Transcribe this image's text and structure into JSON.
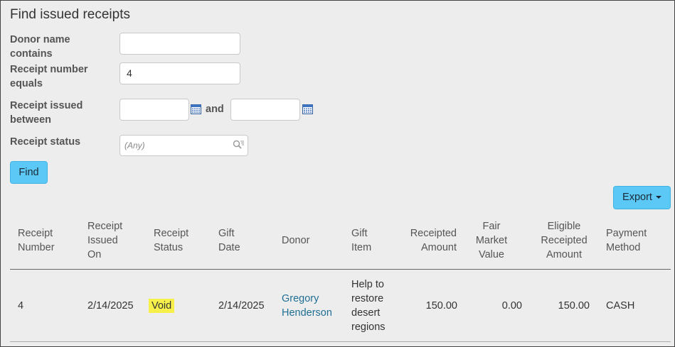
{
  "page": {
    "title": "Find issued receipts"
  },
  "form": {
    "donor_name_label": "Donor name contains",
    "donor_name_value": "",
    "receipt_number_label": "Receipt number equals",
    "receipt_number_value": "4",
    "issued_between_label": "Receipt issued between",
    "issued_from_value": "",
    "issued_and_label": "and",
    "issued_to_value": "",
    "receipt_status_label": "Receipt status",
    "receipt_status_placeholder": "(Any)",
    "find_label": "Find"
  },
  "toolbar": {
    "export_label": "Export"
  },
  "table": {
    "headers": [
      "Receipt Number",
      "Receipt Issued On",
      "Receipt Status",
      "Gift Date",
      "Donor",
      "Gift Item",
      "Receipted Amount",
      "Fair Market Value",
      "Eligible Receipted Amount",
      "Payment Method"
    ],
    "rows": [
      {
        "receipt_number": "4",
        "issued_on": "2/14/2025",
        "status": "Void",
        "gift_date": "2/14/2025",
        "donor": "Gregory Henderson",
        "gift_item": "Help to restore desert regions",
        "receipted_amount": "150.00",
        "fair_market_value": "0.00",
        "eligible_amount": "150.00",
        "payment_method": "CASH"
      }
    ]
  },
  "colors": {
    "button_blue": "#5bc8f5",
    "link_blue": "#1f6f94",
    "void_highlight": "#f7f04a",
    "background": "#ededed"
  },
  "icons": {
    "date_picker": "calendar-icon",
    "status_search": "search-filter-icon",
    "export_menu": "caret-down-icon"
  }
}
